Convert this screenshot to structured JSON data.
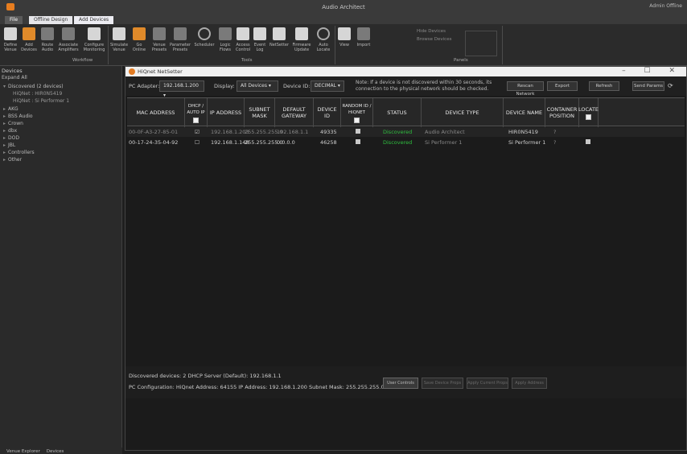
{
  "window": {
    "title": "Audio Architect",
    "controls": "Admin   Offline"
  },
  "ribbon_tabs": [
    "File",
    "Offline Design",
    "Add Devices"
  ],
  "ribbon": {
    "buttons": [
      {
        "label": "Define\nVenue",
        "icon": "define-venue-icon"
      },
      {
        "label": "Add\nDevices",
        "icon": "add-devices-icon"
      },
      {
        "label": "Route\nAudio",
        "icon": "route-audio-icon"
      },
      {
        "label": "Associate\nAmplifiers",
        "icon": "associate-amplifiers-icon"
      },
      {
        "label": "Configure\nMonitoring",
        "icon": "configure-monitoring-icon"
      },
      {
        "label": "Simulate\nVenue",
        "icon": "simulate-venue-icon"
      },
      {
        "label": "Go\nOnline",
        "icon": "go-online-icon"
      },
      {
        "label": "Venue\nPresets",
        "icon": "venue-presets-icon"
      },
      {
        "label": "Parameter\nPresets",
        "icon": "parameter-presets-icon"
      },
      {
        "label": "Scheduler",
        "icon": "scheduler-icon"
      },
      {
        "label": "Logic\nFlows",
        "icon": "logic-flows-icon"
      },
      {
        "label": "Access\nControl",
        "icon": "access-control-icon"
      },
      {
        "label": "Event\nLog",
        "icon": "event-log-icon"
      },
      {
        "label": "NetSetter",
        "icon": "netsetter-icon"
      },
      {
        "label": "Firmware\nUpdate",
        "icon": "firmware-update-icon"
      },
      {
        "label": "Auto\nLocate",
        "icon": "auto-locate-icon"
      },
      {
        "label": "View",
        "icon": "view-icon"
      },
      {
        "label": "Import",
        "icon": "import-icon"
      }
    ],
    "panels": [
      "Hide Devices",
      "Browse Devices"
    ],
    "groups": {
      "workflow": "Workflow",
      "tools": "Tools",
      "panels": "Panels"
    }
  },
  "left": {
    "header": "Devices",
    "subheader": "Expand All",
    "tree": [
      {
        "label": "Discovered (2 devices)",
        "expanded": true
      },
      {
        "label": "HiQNet : HIR0N5419",
        "child": true
      },
      {
        "label": "HiQNet : Si Performer 1",
        "child": true
      },
      {
        "label": "AKG"
      },
      {
        "label": "BSS Audio"
      },
      {
        "label": "Crown"
      },
      {
        "label": "dbx"
      },
      {
        "label": "DOD"
      },
      {
        "label": "JBL"
      },
      {
        "label": "Controllers"
      },
      {
        "label": "Other"
      }
    ],
    "bottom_tabs": [
      "Venue Explorer",
      "Devices"
    ]
  },
  "netsetter": {
    "title": "HiQnet NetSetter",
    "win_controls": "–  ☐  ✕",
    "pc_adapter_label": "PC Adapter:",
    "pc_adapter_value": "192.168.1.200",
    "display_label": "Display:",
    "display_value": "All Devices",
    "device_id_label": "Device ID:",
    "device_id_value": "DECIMAL",
    "note": "Note: If a device is not discovered within 30 seconds, its connection to the physical network should be checked.",
    "buttons": [
      "Rescan Network",
      "Export",
      "Refresh",
      "Send Params"
    ],
    "columns": [
      "MAC ADDRESS",
      "DHCP / AUTO IP",
      "IP ADDRESS",
      "SUBNET MASK",
      "DEFAULT GATEWAY",
      "DEVICE ID",
      "RANDOM ID / HiQNET",
      "STATUS",
      "DEVICE TYPE",
      "DEVICE NAME",
      "CONTAINER POSITION",
      "LOCATE"
    ],
    "rows": [
      {
        "mac": "00-0F-A3-27-85-01",
        "dhcp": "☑",
        "ip": "192.168.1.203",
        "subnet": "255.255.255.0",
        "gateway": "192.168.1.1",
        "id": "49335",
        "status": "Discovered",
        "type": "Audio Architect",
        "name": "HIR0N5419",
        "container": "?"
      },
      {
        "mac": "00-17-24-35-04-92",
        "dhcp": "☐",
        "ip": "192.168.1.148",
        "subnet": "255.255.255.0",
        "gateway": "0.0.0.0",
        "id": "46258",
        "status": "Discovered",
        "type": "Si Performer 1",
        "name": "Si Performer 1",
        "container": "?"
      }
    ],
    "footer": {
      "line1": "Discovered devices: 2     DHCP Server (Default): 192.168.1.1",
      "line2": "PC Configuration:   HiQnet Address: 64155    IP Address: 192.168.1.200    Subnet Mask: 255.255.255.0",
      "buttons": [
        "User Controls",
        "Save Device Props",
        "Apply Current Props",
        "Apply Address"
      ]
    }
  }
}
